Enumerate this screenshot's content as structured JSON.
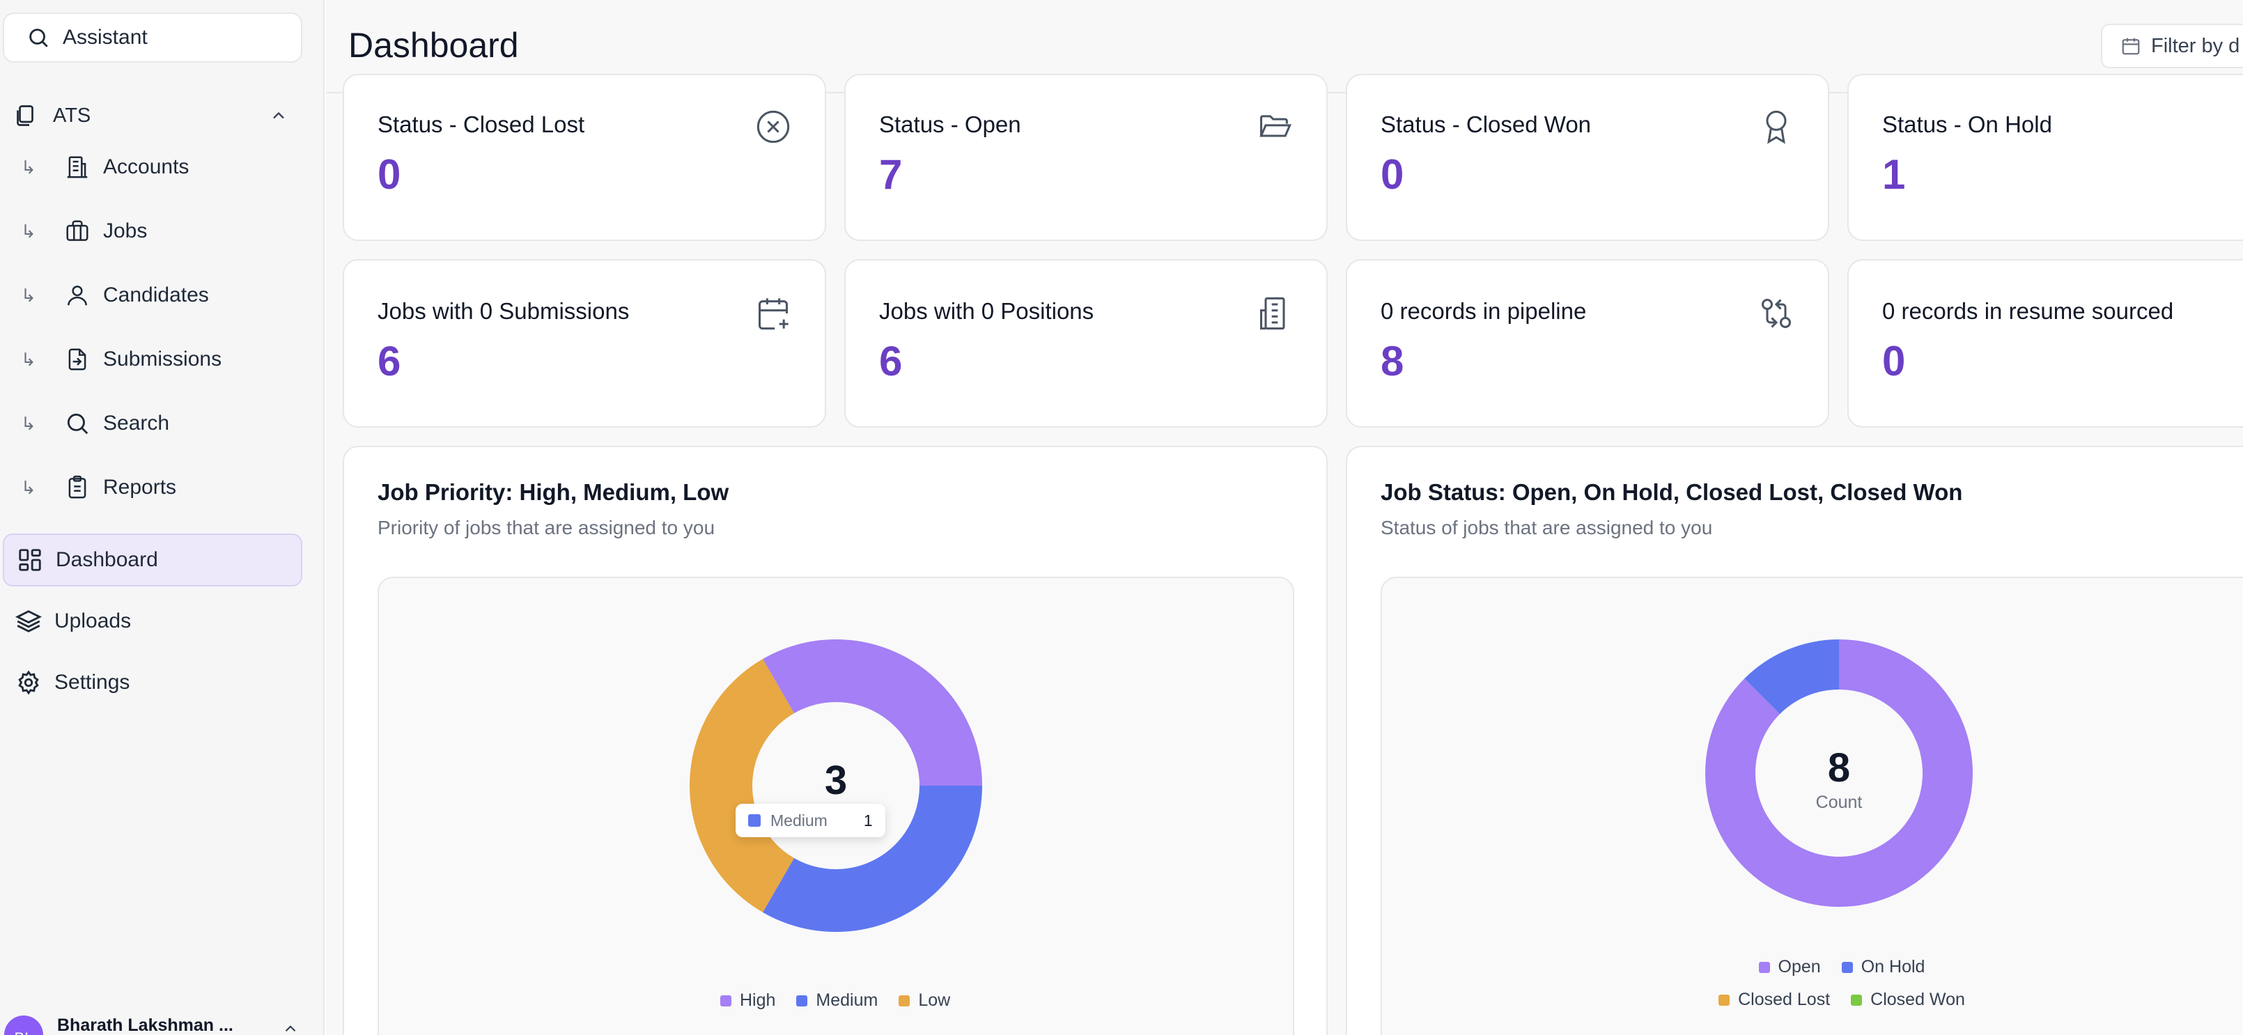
{
  "sidebar": {
    "search_label": "Assistant",
    "group_label": "ATS",
    "sub_items": [
      {
        "label": "Accounts",
        "icon": "building-icon"
      },
      {
        "label": "Jobs",
        "icon": "briefcase-icon"
      },
      {
        "label": "Candidates",
        "icon": "user-icon"
      },
      {
        "label": "Submissions",
        "icon": "file-import-icon"
      },
      {
        "label": "Search",
        "icon": "search-icon"
      },
      {
        "label": "Reports",
        "icon": "clipboard-icon"
      }
    ],
    "nav_items": [
      {
        "label": "Dashboard",
        "icon": "dashboard-grid-icon",
        "active": true
      },
      {
        "label": "Uploads",
        "icon": "layers-icon",
        "active": false
      },
      {
        "label": "Settings",
        "icon": "gear-icon",
        "active": false
      }
    ],
    "user": {
      "initials": "BL",
      "name": "Bharath Lakshman ..."
    }
  },
  "header": {
    "title": "Dashboard",
    "filter_label": "Filter by d"
  },
  "stats_row1": [
    {
      "title": "Status - Closed Lost",
      "value": "0",
      "icon": "x-circle-icon"
    },
    {
      "title": "Status - Open",
      "value": "7",
      "icon": "folder-open-icon"
    },
    {
      "title": "Status - Closed Won",
      "value": "0",
      "icon": "award-icon"
    },
    {
      "title": "Status - On Hold",
      "value": "1",
      "icon": ""
    }
  ],
  "stats_row2": [
    {
      "title": "Jobs with 0 Submissions",
      "value": "6",
      "icon": "calendar-plus-icon"
    },
    {
      "title": "Jobs with 0 Positions",
      "value": "6",
      "icon": "building-icon"
    },
    {
      "title": "0 records in pipeline",
      "value": "8",
      "icon": "git-compare-icon"
    },
    {
      "title": "0 records in resume sourced",
      "value": "0",
      "icon": ""
    }
  ],
  "charts": {
    "priority": {
      "title": "Job Priority: High, Medium, Low",
      "subtitle": "Priority of jobs that are assigned to you",
      "center_value": "3",
      "tooltip": {
        "label": "Medium",
        "value": "1"
      }
    },
    "status": {
      "title": "Job Status: Open, On Hold, Closed Lost, Closed Won",
      "subtitle": "Status of jobs that are assigned to you",
      "center_value": "8",
      "center_label": "Count"
    }
  },
  "chart_data": [
    {
      "type": "pie",
      "categories": [
        "High",
        "Medium",
        "Low"
      ],
      "values": [
        1,
        1,
        1
      ],
      "colors": [
        "#a47ff5",
        "#5e77f0",
        "#e8a843"
      ],
      "total": 3
    },
    {
      "type": "pie",
      "categories": [
        "Open",
        "On Hold",
        "Closed Lost",
        "Closed Won"
      ],
      "values": [
        7,
        1,
        0,
        0
      ],
      "colors": [
        "#a47ff5",
        "#5e77f0",
        "#e8a843",
        "#7ac943"
      ],
      "total": 8
    }
  ]
}
